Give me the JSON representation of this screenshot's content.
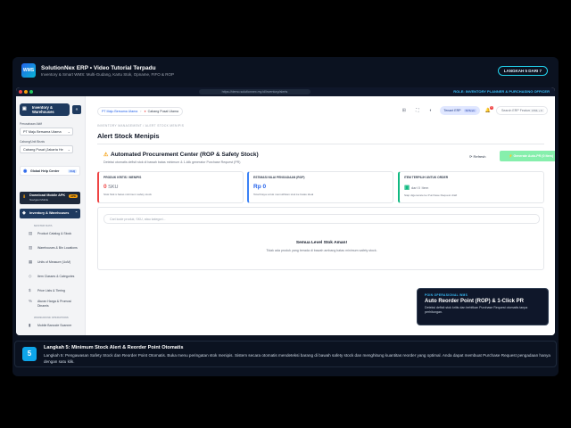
{
  "banner": {
    "logo": "WMS",
    "title": "SolutionNex ERP • Video Tutorial Terpadu",
    "subtitle": "Inventory & Smart WMS: Multi-Gudang, Kartu Stok, Opname, FIFO & ROP",
    "step_chip": "LANGKAH 5 DARI 7"
  },
  "browser": {
    "url": "https://demo.solutionnex.my.id/inventory/alerts",
    "role": "ROLE: INVENTORY PLANNER & PURCHASING OFFICER"
  },
  "sidebar": {
    "module": "Inventory & Warehouses",
    "company_label": "Perusahaan Aktif",
    "company": "PT Maju Bersama Utama",
    "branch_label": "Cabang/Unit Bisnis",
    "branch": "Cabang Pusat (Jakarta He",
    "help_center": "Global Help Center",
    "help_tag": "FAQ",
    "download_title": "Download Mobile APK",
    "download_sub": "Navigasi Mobile",
    "download_tag": "APK",
    "inventory_menu": "Inventory & Warehouses",
    "section_master": "MASTER DATA",
    "items": [
      "Product Catalog & Stock",
      "Warehouses & Bin Locations",
      "Units of Measure (UoM)",
      "Item Classes & Categories",
      "Price Lists & Tiering",
      "Aturan Harga & Promosi Dinamis"
    ],
    "section_ops": "WAREHOUSE OPERATIONS",
    "ops_items": [
      "Mobile Barcode Scanner"
    ]
  },
  "header": {
    "company_pill": "PT Maju Bersama Utama",
    "branch_pill": "Cabang Pusat Utama",
    "tenant": "Tenant ERP",
    "tenant_version": "SYS-v1",
    "notif_count": "1",
    "search_placeholder": "Search ERP Features...",
    "search_kbd": "CTRL + K"
  },
  "page": {
    "breadcrumb": "INVENTORY MANAGEMENT / ALERT STOCK MENIPIS",
    "title": "Alert Stock Menipis",
    "section_title": "Automated Procurement Center (ROP & Safety Stock)",
    "section_desc": "Deteksi otomatis defisit stok di bawah batas minimum & 1-klik generator Purchase Request (PR)",
    "refresh": "Refresh",
    "generate": "Generate Auto-PR (0 Item)",
    "cards": [
      {
        "label": "PRODUK KRITIS / MENIPIS",
        "value": "0",
        "unit": "SKU",
        "note": "Stok fisik ≤ batas minimum safety stock"
      },
      {
        "label": "ESTIMASI NILAI PENGADAAN (ROP)",
        "value": "Rp 0",
        "unit": "",
        "note": "Total biaya untuk memulihkan stok ke batas ideal"
      },
      {
        "label": "ITEM TERPILIH UNTUK ORDER",
        "value": "dari 0",
        "unit": "Item",
        "note": "Siap digenerate ke Purchase Request draft"
      }
    ],
    "filter_placeholder": "Cari kode produk, SKU, atau kategori...",
    "empty_title": "Semua Level Stok Aman!",
    "empty_sub": "Tidak ada produk yang berada di bawah ambang batas minimum safety stock."
  },
  "tooltip": {
    "eyebrow": "POIN OPERASIONAL WMS",
    "title": "Auto Reorder Point (ROP) & 1-Click PR",
    "desc": "Deteksi defisit stok kritis dan terbitkan Purchase Request otomatis tanpa perhitungan."
  },
  "step": {
    "number": "5",
    "title": "Langkah 5: Minimum Stock Alert & Reorder Point Otomatis",
    "desc": "Langkah 5: Pengawasan Safety Stock dan Reorder Point Otomatis. Buka menu peringatan stok menipis. Sistem secara otomatis mendeteksi barang di bawah safety stock dan menghitung kuantitas reorder yang optimal. Anda dapat membuat Purchase Request pengadaan hanya dengan satu klik."
  },
  "colors": {
    "accent": "#1e3a5f",
    "cta": "#86efac",
    "brand": "#0ea5e9"
  }
}
